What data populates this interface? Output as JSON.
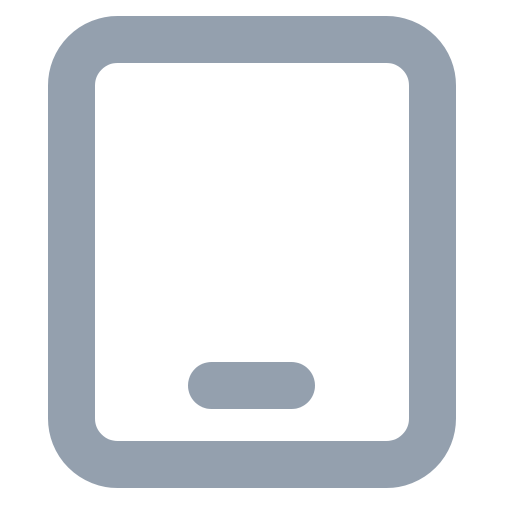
{
  "icon": {
    "name": "tablet-icon",
    "stroke_color": "#94A0AE",
    "background_color": "#FFFFFF"
  }
}
